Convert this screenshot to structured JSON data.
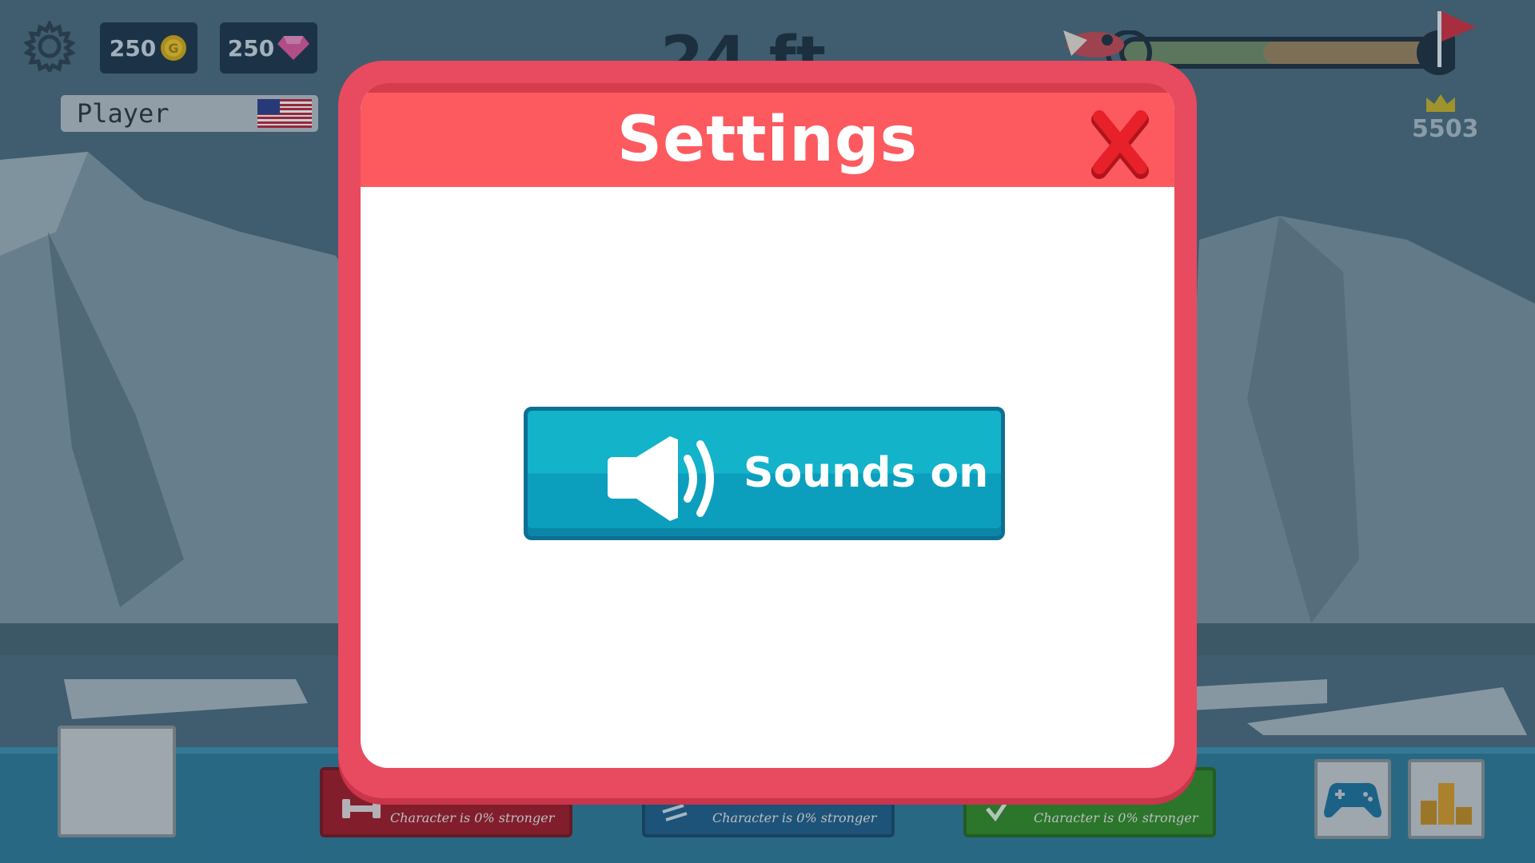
{
  "hud": {
    "coins": "250",
    "gems": "250",
    "player_name": "Player",
    "distance": "24 ft",
    "best_score": "5503"
  },
  "upgrades": [
    {
      "label": "Character is 0% stronger",
      "color": "#a3141f"
    },
    {
      "label": "Character is 0% stronger",
      "color": "#1c5b86"
    },
    {
      "label": "Character is 0% stronger",
      "color": "#2f8a1e"
    }
  ],
  "modal": {
    "title": "Settings",
    "sound_button_label": "Sounds on"
  },
  "colors": {
    "modal_frame": "#e84a5f",
    "modal_header": "#fc5a5f",
    "sound_button": "#13b3c9",
    "close_x": "#e8202a"
  },
  "icons": [
    "gear-icon",
    "coin-icon",
    "gem-icon",
    "us-flag-icon",
    "crown-icon",
    "close-icon",
    "speaker-icon",
    "gamepad-icon",
    "leaderboard-icon"
  ]
}
